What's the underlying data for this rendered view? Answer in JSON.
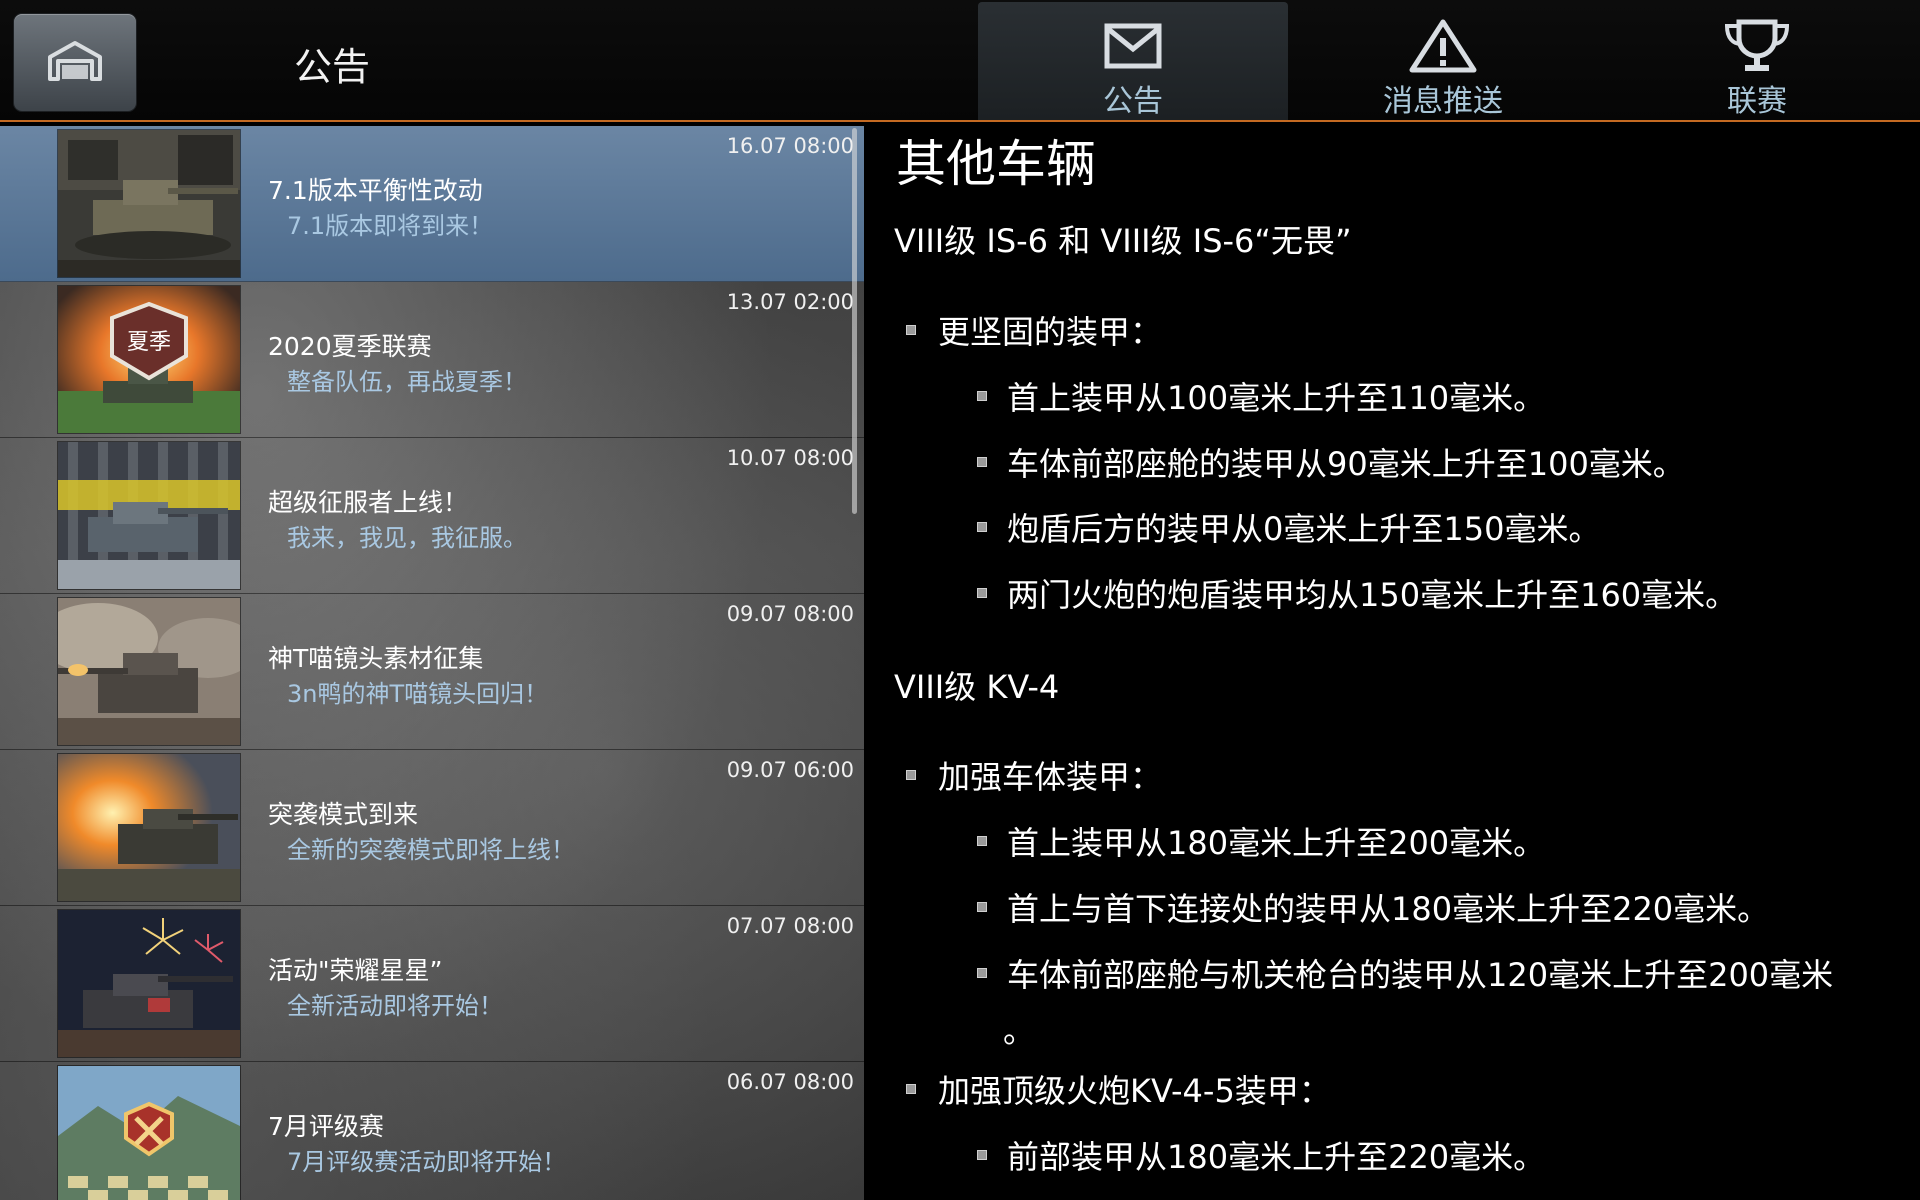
{
  "header": {
    "title": "公告",
    "tabs": [
      {
        "label": "公告",
        "icon": "envelope-icon",
        "active": true
      },
      {
        "label": "消息推送",
        "icon": "warning-icon",
        "active": false
      },
      {
        "label": "联赛",
        "icon": "trophy-icon",
        "active": false
      }
    ]
  },
  "news": [
    {
      "date": "16.07 08:00",
      "title": "7.1版本平衡性改动",
      "subtitle": "7.1版本即将到来！",
      "selected": true
    },
    {
      "date": "13.07 02:00",
      "title": "2020夏季联赛",
      "subtitle": "整备队伍，再战夏季！",
      "badge": "夏季"
    },
    {
      "date": "10.07 08:00",
      "title": "超级征服者上线！",
      "subtitle": "我来，我见，我征服。"
    },
    {
      "date": "09.07 08:00",
      "title": "神T喵镜头素材征集",
      "subtitle": "3n鸭的神T喵镜头回归！"
    },
    {
      "date": "09.07 06:00",
      "title": "突袭模式到来",
      "subtitle": "全新的突袭模式即将上线！"
    },
    {
      "date": "07.07 08:00",
      "title": "活动\"荣耀星星”",
      "subtitle": "全新活动即将开始！"
    },
    {
      "date": "06.07 08:00",
      "title": "7月评级赛",
      "subtitle": "7月评级赛活动即将开始！"
    }
  ],
  "article": {
    "heading": "其他车辆",
    "section1": "VIII级 IS-6 和 VIII级 IS-6“无畏”",
    "s1_b1": "更坚固的装甲：",
    "s1_b1_items": [
      "首上装甲从100毫米上升至110毫米。",
      "车体前部座舱的装甲从90毫米上升至100毫米。",
      "炮盾后方的装甲从0毫米上升至150毫米。",
      "两门火炮的炮盾装甲均从150毫米上升至160毫米。"
    ],
    "section2": "VIII级 KV-4",
    "s2_b1": "加强车体装甲：",
    "s2_b1_items": [
      "首上装甲从180毫米上升至200毫米。",
      "首上与首下连接处的装甲从180毫米上升至220毫米。",
      "车体前部座舱与机关枪台的装甲从120毫米上升至200毫米"
    ],
    "s2_b1_tail": "。",
    "s2_b2": "加强顶级火炮KV-4-5装甲：",
    "s2_b2_items": [
      "前部装甲从180毫米上升至220毫米。"
    ]
  }
}
